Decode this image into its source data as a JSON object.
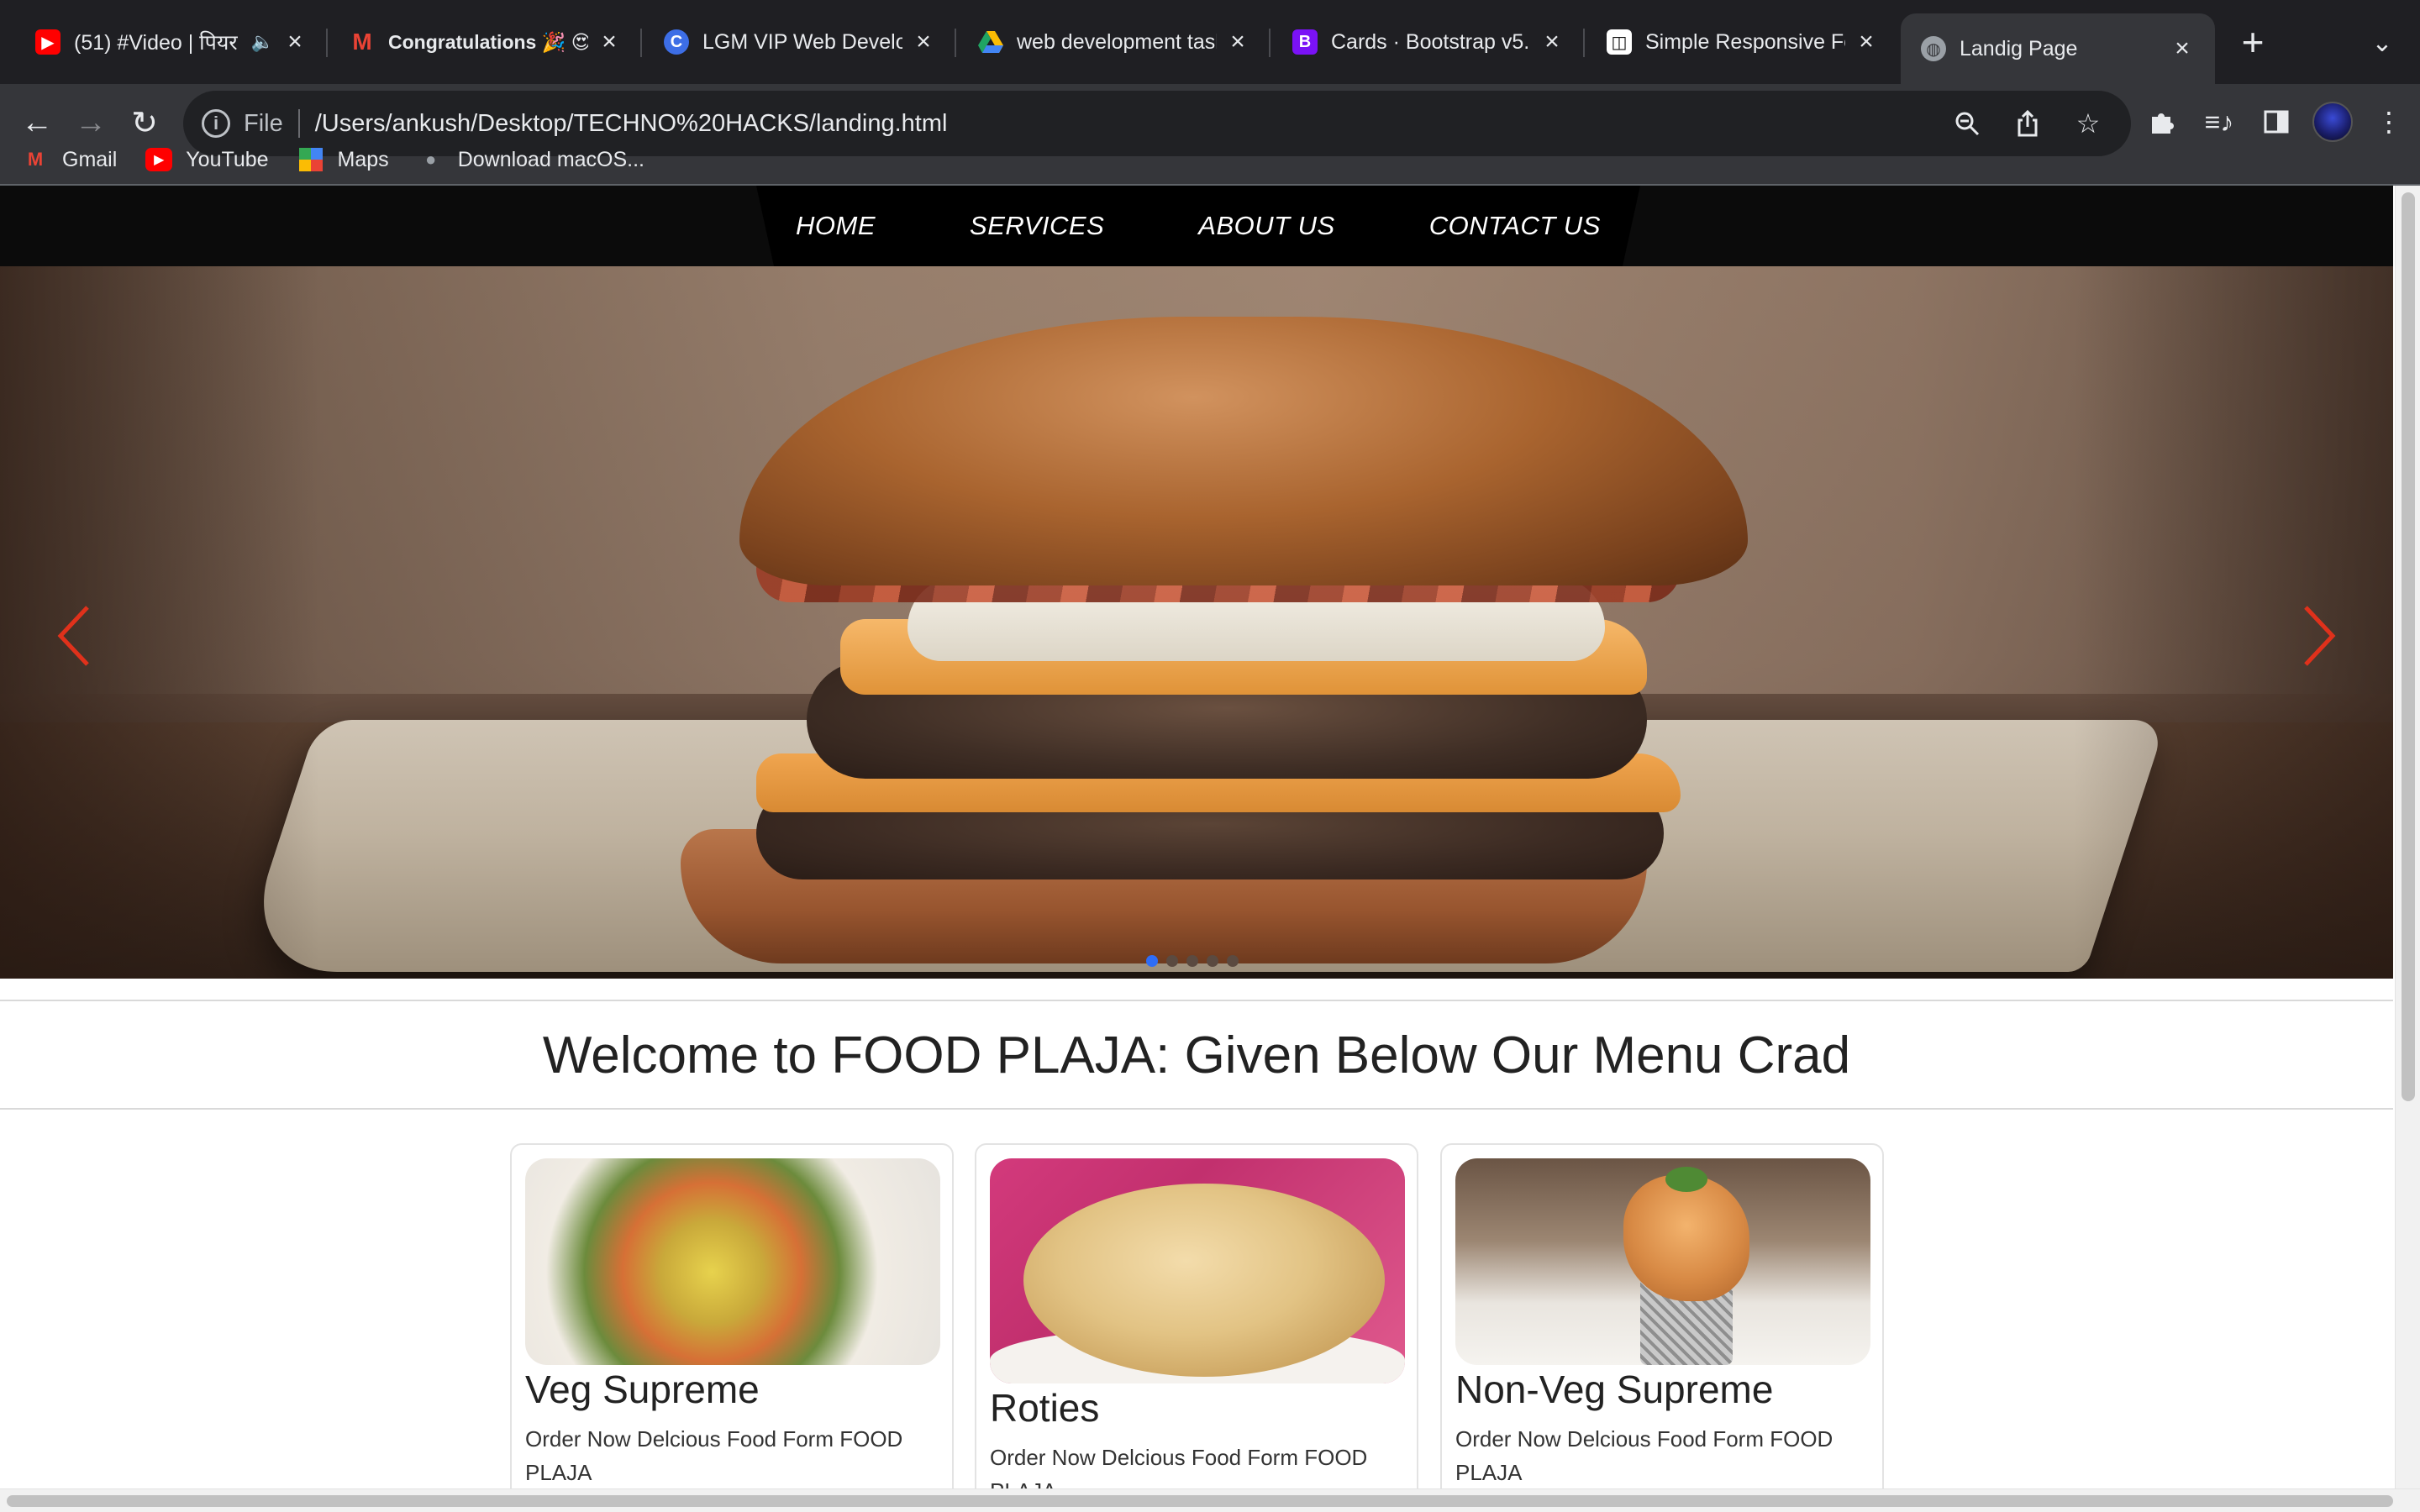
{
  "browser": {
    "tabs": [
      {
        "title": "(51) #Video | पियर",
        "icon": "youtube-icon",
        "color": "#ff0000",
        "muted": true
      },
      {
        "title": "Congratulations 🎉 😍",
        "icon": "gmail-icon",
        "color": "#ea4335"
      },
      {
        "title": "LGM VIP Web Develop",
        "icon": "lgm-icon",
        "color": "#3d6ee6"
      },
      {
        "title": "web development task",
        "icon": "google-drive-icon",
        "color": "#1fa463"
      },
      {
        "title": "Cards · Bootstrap v5.",
        "icon": "bootstrap-icon",
        "color": "#7a12f6"
      },
      {
        "title": "Simple Responsive Fo",
        "icon": "codepen-icon",
        "color": "#ffffff"
      },
      {
        "title": "Landig Page",
        "icon": "globe-icon",
        "color": "#9aa0a6",
        "active": true
      }
    ],
    "new_tab": "+",
    "address": {
      "scheme": "File",
      "url": "/Users/ankush/Desktop/TECHNO%20HACKS/landing.html"
    },
    "bookmarks": [
      {
        "label": "Gmail",
        "icon": "gmail-icon"
      },
      {
        "label": "YouTube",
        "icon": "youtube-icon"
      },
      {
        "label": "Maps",
        "icon": "maps-icon"
      },
      {
        "label": "Download macOS...",
        "icon": "apple-icon"
      }
    ]
  },
  "site": {
    "nav": [
      "HOME",
      "SERVICES",
      "ABOUT US",
      "CONTACT US"
    ],
    "carousel": {
      "slides": 5,
      "active_index": 0,
      "accent": "#e0311b"
    },
    "welcome": "Welcome to FOOD PLAJA: Given Below Our Menu Crad",
    "cards": [
      {
        "title": "Veg Supreme",
        "text": "Order Now Delcious Food Form FOOD PLAJA"
      },
      {
        "title": "Roties",
        "text": "Order Now Delcious Food Form FOOD PLAJA"
      },
      {
        "title": "Non-Veg Supreme",
        "text": "Order Now Delcious Food Form FOOD PLAJA"
      }
    ]
  }
}
